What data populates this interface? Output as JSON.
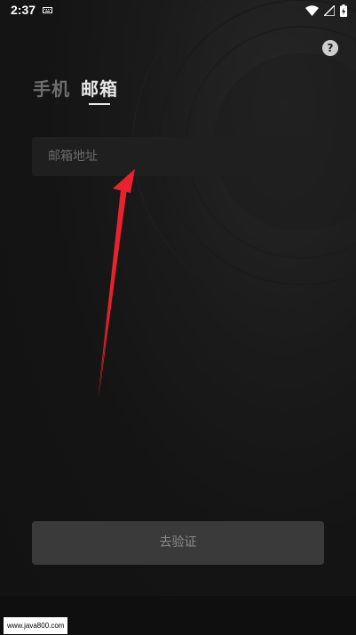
{
  "status_bar": {
    "time": "2:37"
  },
  "help": {
    "icon_glyph": "?"
  },
  "tabs": [
    {
      "label": "手机",
      "active": false
    },
    {
      "label": "邮箱",
      "active": true
    }
  ],
  "email_input": {
    "placeholder": "邮箱地址",
    "value": ""
  },
  "verify_button": {
    "label": "去验证"
  },
  "watermark": {
    "text": "www.java800.com"
  },
  "colors": {
    "background": "#141414",
    "annotation_arrow": "#e8232d",
    "button_background": "#3a3a3a"
  }
}
